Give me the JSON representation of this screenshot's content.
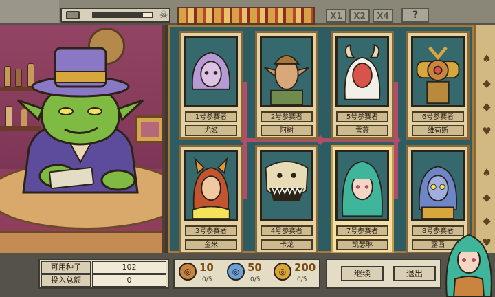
{
  "top_bar": {
    "menu_icon": "menu-icon",
    "progress": 0.85,
    "speed_buttons": [
      "X1",
      "X2",
      "X4"
    ],
    "help_label": "?",
    "skull_icon": "skull-icon"
  },
  "scene": {
    "character": "goblin-dealer",
    "colors": {
      "wall": "#8f3f5e",
      "skin": "#7fba43",
      "hat": "#8a78c4"
    }
  },
  "contestants": [
    {
      "number_label": "1号参赛者",
      "name": "尤姬",
      "portrait": "portrait-medusa",
      "highlight": false
    },
    {
      "number_label": "2号参赛者",
      "name": "阿树",
      "portrait": "portrait-elf",
      "highlight": false
    },
    {
      "number_label": "5号参赛者",
      "name": "雪薇",
      "portrait": "portrait-horned-girl",
      "highlight": false
    },
    {
      "number_label": "6号参赛者",
      "name": "维苟斯",
      "portrait": "portrait-eye-robot",
      "highlight": false
    },
    {
      "number_label": "3号参赛者",
      "name": "金米",
      "portrait": "portrait-fox-girl",
      "highlight": false
    },
    {
      "number_label": "4号参赛者",
      "name": "卡龙",
      "portrait": "portrait-skeleton-dragon",
      "highlight": false
    },
    {
      "number_label": "7号参赛者",
      "name": "凯瑟琳",
      "portrait": "portrait-green-hair-girl",
      "highlight": true
    },
    {
      "number_label": "8号参赛者",
      "name": "露西",
      "portrait": "portrait-blue-alien",
      "highlight": false
    }
  ],
  "suits": [
    "♠",
    "◆",
    "◆",
    "♥",
    "♠",
    "◆",
    "◆",
    "♥"
  ],
  "stats": {
    "seeds_label": "可用种子",
    "seeds_value": "102",
    "bet_label": "投入总额",
    "bet_value": "0"
  },
  "chips": [
    {
      "value": "10",
      "count": "0/5",
      "icon": "bronze-chip-icon",
      "color": "#c9853f"
    },
    {
      "value": "50",
      "count": "0/5",
      "icon": "blue-chip-icon",
      "color": "#6ea0d8"
    },
    {
      "value": "200",
      "count": "0/5",
      "icon": "gold-chip-icon",
      "color": "#d9a636"
    }
  ],
  "actions": {
    "continue_label": "继续",
    "exit_label": "退出"
  },
  "avatar": {
    "icon": "player-avatar"
  }
}
